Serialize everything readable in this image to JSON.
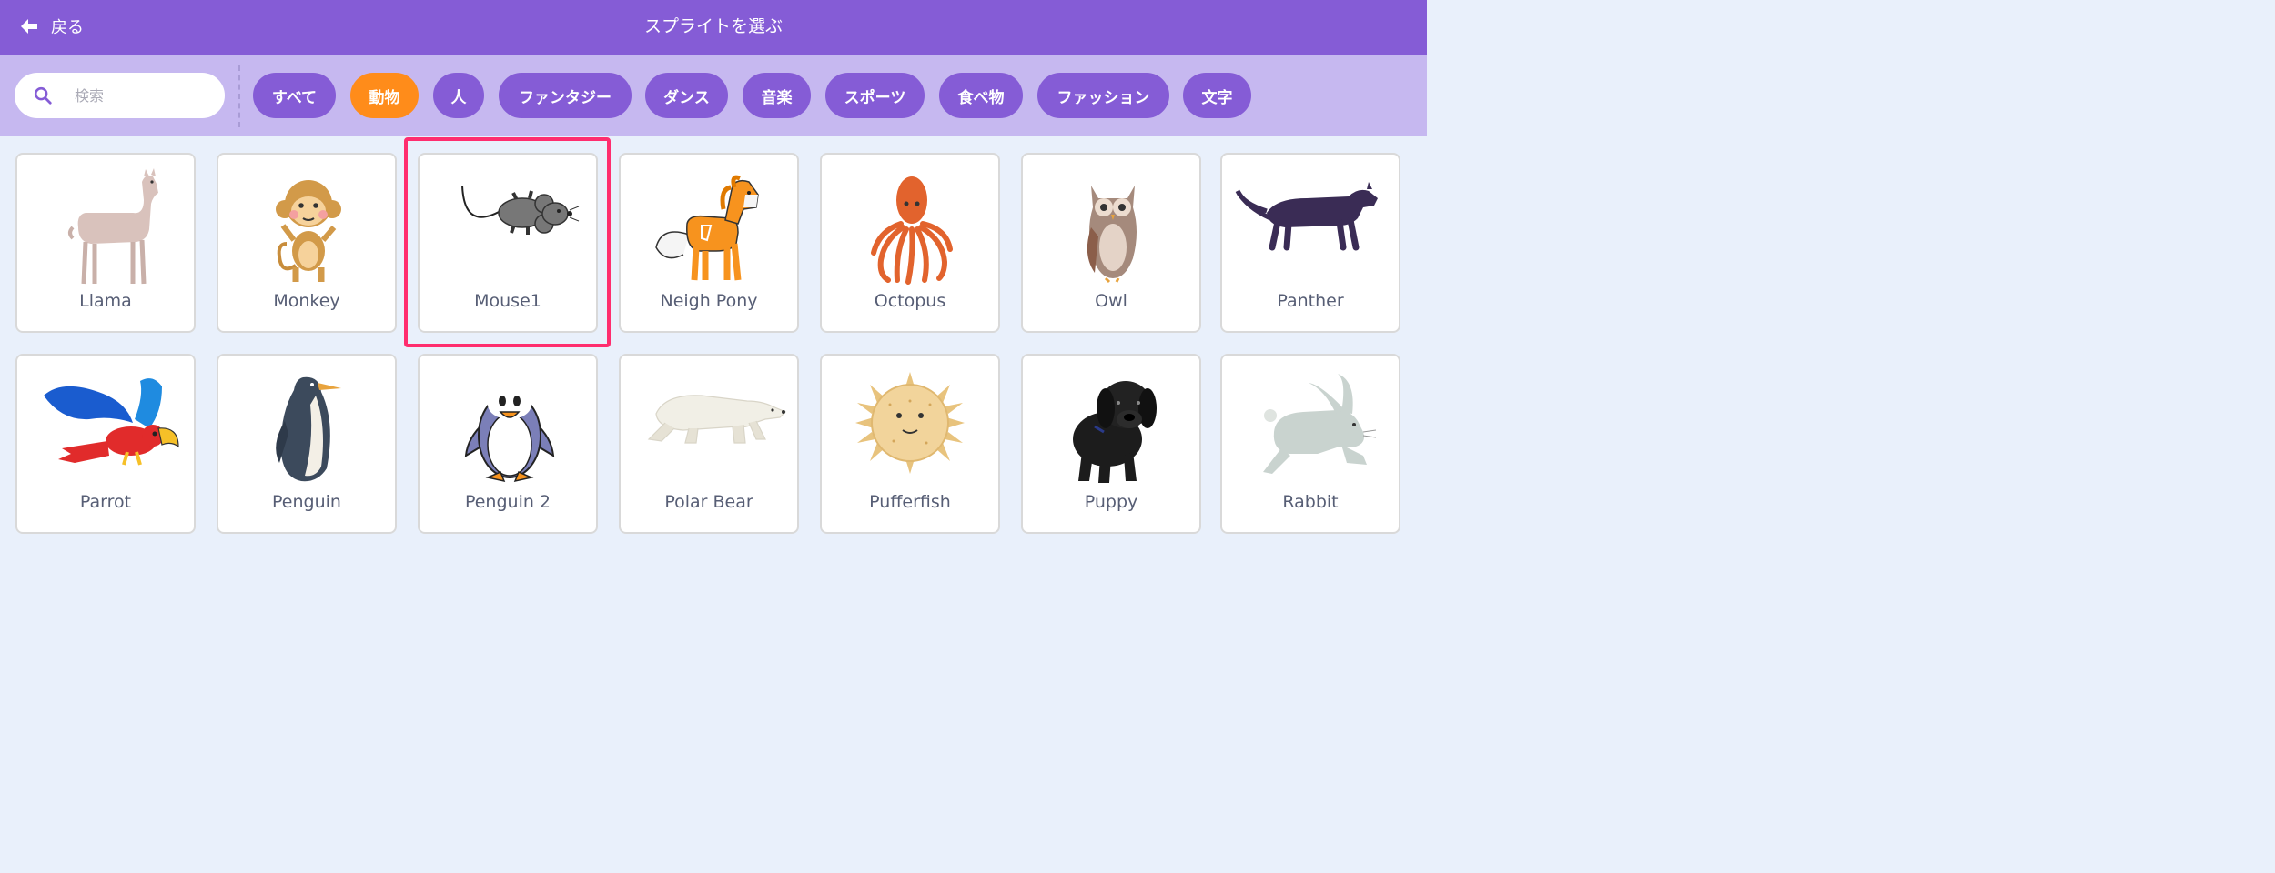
{
  "header": {
    "back_label": "戻る",
    "title": "スプライトを選ぶ",
    "color": "#855cd6"
  },
  "search": {
    "placeholder": "検索",
    "value": ""
  },
  "categories": [
    {
      "label": "すべて",
      "active": false
    },
    {
      "label": "動物",
      "active": true
    },
    {
      "label": "人",
      "active": false
    },
    {
      "label": "ファンタジー",
      "active": false
    },
    {
      "label": "ダンス",
      "active": false
    },
    {
      "label": "音楽",
      "active": false
    },
    {
      "label": "スポーツ",
      "active": false
    },
    {
      "label": "食べ物",
      "active": false
    },
    {
      "label": "ファッション",
      "active": false
    },
    {
      "label": "文字",
      "active": false
    }
  ],
  "sprites": [
    {
      "name": "Llama",
      "icon": "llama-icon"
    },
    {
      "name": "Monkey",
      "icon": "monkey-icon"
    },
    {
      "name": "Mouse1",
      "icon": "mouse-icon",
      "highlighted": true
    },
    {
      "name": "Neigh Pony",
      "icon": "pony-icon"
    },
    {
      "name": "Octopus",
      "icon": "octopus-icon"
    },
    {
      "name": "Owl",
      "icon": "owl-icon"
    },
    {
      "name": "Panther",
      "icon": "panther-icon"
    },
    {
      "name": "Parrot",
      "icon": "parrot-icon"
    },
    {
      "name": "Penguin",
      "icon": "penguin-icon"
    },
    {
      "name": "Penguin 2",
      "icon": "penguin2-icon"
    },
    {
      "name": "Polar Bear",
      "icon": "polar-bear-icon"
    },
    {
      "name": "Pufferfish",
      "icon": "pufferfish-icon"
    },
    {
      "name": "Puppy",
      "icon": "puppy-icon"
    },
    {
      "name": "Rabbit",
      "icon": "rabbit-icon"
    }
  ],
  "colors": {
    "accent": "#855cd6",
    "active_tag": "#ff8c1a",
    "highlight": "#ff2d6e"
  }
}
